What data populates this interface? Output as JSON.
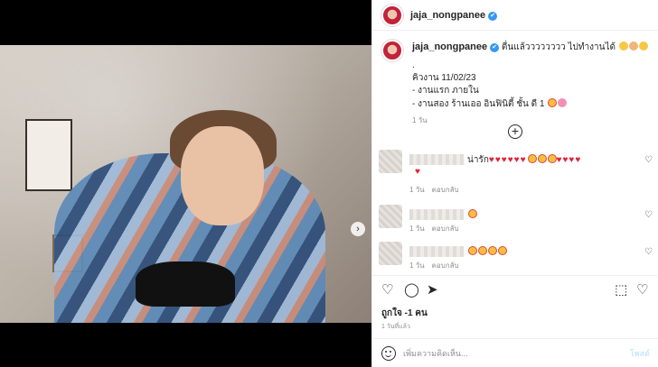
{
  "post": {
    "username": "jaja_nongpanee",
    "verified_symbol": "✔",
    "carousel": {
      "next_symbol": "›",
      "dots": 4,
      "active_dot": 0
    }
  },
  "caption": {
    "username": "jaja_nongpanee",
    "text": "ตื่นแล้วววววววว ไปทำงานได้",
    "separator": ".",
    "date_line": "คิวงาน 11/02/23",
    "items": [
      "- งานแรก ภายใน",
      "- งานสอง ร้านเออ อินฟินิตี้ ชั้น ดี 1"
    ],
    "time": "1 วัน"
  },
  "load_more_symbol": "+",
  "comments": [
    {
      "text": "น่ารัก",
      "time": "1 วัน",
      "reply": "ตอบกลับ"
    },
    {
      "text": "",
      "time": "1 วัน",
      "reply": "ตอบกลับ"
    },
    {
      "text": "",
      "time": "1 วัน",
      "reply": "ตอบกลับ"
    }
  ],
  "actions": {
    "like": "♡",
    "comment": "◯",
    "share": "➤",
    "save": "⬚",
    "like_comment": "♡"
  },
  "likes_text": "ถูกใจ -1 คน",
  "post_time": "1 วันที่แล้ว",
  "composer": {
    "placeholder": "เพิ่มความคิดเห็น...",
    "post_label": "โพสต์"
  },
  "colors": {
    "accent": "#3897f0",
    "heart": "#e0243a",
    "post_disabled": "#b2dffc"
  }
}
